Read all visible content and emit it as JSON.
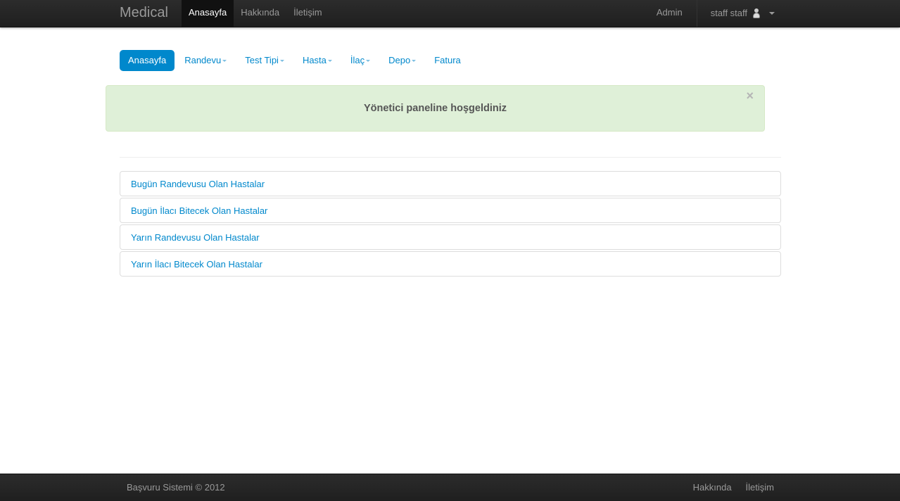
{
  "navbar": {
    "brand": "Medical",
    "items": [
      {
        "label": "Anasayfa",
        "active": true
      },
      {
        "label": "Hakkında",
        "active": false
      },
      {
        "label": "İletişim",
        "active": false
      }
    ],
    "admin_label": "Admin",
    "user_label": "staff staff"
  },
  "pills": [
    {
      "label": "Anasayfa",
      "active": true,
      "dropdown": false
    },
    {
      "label": "Randevu",
      "active": false,
      "dropdown": true
    },
    {
      "label": "Test Tipi",
      "active": false,
      "dropdown": true
    },
    {
      "label": "Hasta",
      "active": false,
      "dropdown": true
    },
    {
      "label": "İlaç",
      "active": false,
      "dropdown": true
    },
    {
      "label": "Depo",
      "active": false,
      "dropdown": true
    },
    {
      "label": "Fatura",
      "active": false,
      "dropdown": false
    }
  ],
  "alert": {
    "message": "Yönetici paneline hoşgeldiniz",
    "close_glyph": "×"
  },
  "list": [
    {
      "label": "Bugün Randevusu Olan Hastalar"
    },
    {
      "label": "Bugün İlacı Bitecek Olan Hastalar"
    },
    {
      "label": "Yarın Randevusu Olan Hastalar"
    },
    {
      "label": "Yarın İlacı Bitecek Olan Hastalar"
    }
  ],
  "footer": {
    "copyright": "Başvuru Sistemi © 2012",
    "links": [
      "Hakkında",
      "İletişim"
    ]
  },
  "colors": {
    "navbar_bg": "#222222",
    "accent": "#0088cc",
    "alert_bg": "#dff0d8"
  }
}
